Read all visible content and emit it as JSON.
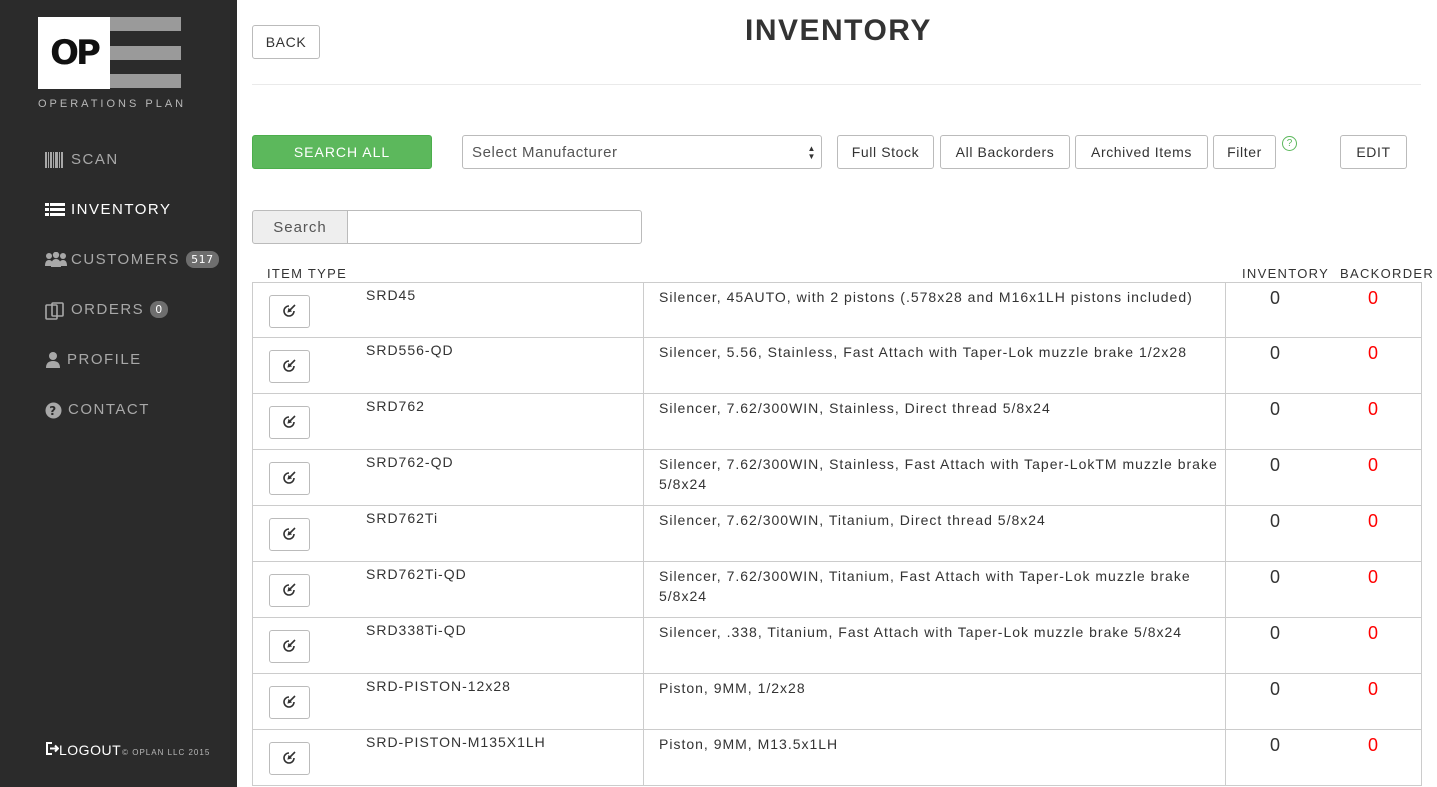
{
  "sidebar": {
    "logo_text": "OP",
    "brand": "OPERATIONS PLAN",
    "nav": [
      {
        "label": "SCAN",
        "icon": "barcode-icon",
        "active": false
      },
      {
        "label": "INVENTORY",
        "icon": "list-icon",
        "active": true
      },
      {
        "label": "CUSTOMERS",
        "icon": "users-icon",
        "active": false,
        "badge": "517"
      },
      {
        "label": "ORDERS",
        "icon": "clipboard-icon",
        "active": false,
        "badge": "0"
      },
      {
        "label": "PROFILE",
        "icon": "user-icon",
        "active": false
      },
      {
        "label": "CONTACT",
        "icon": "question-circle-icon",
        "active": false
      }
    ],
    "logout_label": "LOGOUT",
    "copyright": "© OPLAN LLC 2015"
  },
  "header": {
    "back_label": "BACK",
    "title": "INVENTORY"
  },
  "toolbar": {
    "search_all_label": "SEARCH ALL",
    "manufacturer_placeholder": "Select Manufacturer",
    "full_stock_label": "Full Stock",
    "all_backorders_label": "All Backorders",
    "archived_items_label": "Archived Items",
    "filter_label": "Filter",
    "help_label": "?",
    "edit_label": "EDIT"
  },
  "search": {
    "label": "Search",
    "value": ""
  },
  "table": {
    "headers": {
      "item_type": "ITEM TYPE",
      "inventory": "INVENTORY",
      "backorder": "BACKORDER"
    },
    "rows": [
      {
        "code": "SRD45",
        "description": "Silencer, 45AUTO, with 2 pistons (.578x28 and M16x1LH pistons included)",
        "inventory": "0",
        "backorder": "0"
      },
      {
        "code": "SRD556-QD",
        "description": "Silencer, 5.56, Stainless, Fast Attach with Taper-Lok muzzle brake 1/2x28",
        "inventory": "0",
        "backorder": "0"
      },
      {
        "code": "SRD762",
        "description": "Silencer, 7.62/300WIN, Stainless, Direct thread 5/8x24",
        "inventory": "0",
        "backorder": "0"
      },
      {
        "code": "SRD762-QD",
        "description": "Silencer, 7.62/300WIN, Stainless, Fast Attach with Taper-LokTM muzzle brake 5/8x24",
        "inventory": "0",
        "backorder": "0"
      },
      {
        "code": "SRD762Ti",
        "description": "Silencer, 7.62/300WIN, Titanium, Direct thread 5/8x24",
        "inventory": "0",
        "backorder": "0"
      },
      {
        "code": "SRD762Ti-QD",
        "description": "Silencer, 7.62/300WIN, Titanium, Fast Attach with Taper-Lok muzzle brake 5/8x24",
        "inventory": "0",
        "backorder": "0"
      },
      {
        "code": "SRD338Ti-QD",
        "description": "Silencer, .338, Titanium, Fast Attach with Taper-Lok muzzle brake 5/8x24",
        "inventory": "0",
        "backorder": "0"
      },
      {
        "code": "SRD-PISTON-12x28",
        "description": "Piston, 9MM, 1/2x28",
        "inventory": "0",
        "backorder": "0"
      },
      {
        "code": "SRD-PISTON-M135X1LH",
        "description": "Piston, 9MM, M13.5x1LH",
        "inventory": "0",
        "backorder": "0"
      }
    ]
  },
  "colors": {
    "sidebar_bg": "#2b2b2b",
    "accent_green": "#5cb85c",
    "backorder_red": "#ff0000"
  }
}
